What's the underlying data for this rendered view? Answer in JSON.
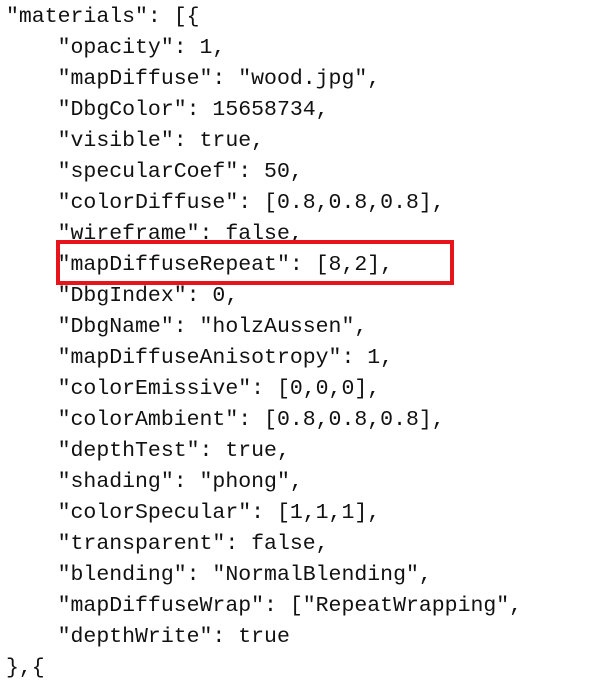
{
  "code": {
    "lines": [
      "\"materials\": [{",
      "    \"opacity\": 1,",
      "    \"mapDiffuse\": \"wood.jpg\",",
      "    \"DbgColor\": 15658734,",
      "    \"visible\": true,",
      "    \"specularCoef\": 50,",
      "    \"colorDiffuse\": [0.8,0.8,0.8],",
      "    \"wireframe\": false,",
      "    \"mapDiffuseRepeat\": [8,2],",
      "    \"DbgIndex\": 0,",
      "    \"DbgName\": \"holzAussen\",",
      "    \"mapDiffuseAnisotropy\": 1,",
      "    \"colorEmissive\": [0,0,0],",
      "    \"colorAmbient\": [0.8,0.8,0.8],",
      "    \"depthTest\": true,",
      "    \"shading\": \"phong\",",
      "    \"colorSpecular\": [1,1,1],",
      "    \"transparent\": false,",
      "    \"blending\": \"NormalBlending\",",
      "    \"mapDiffuseWrap\": [\"RepeatWrapping\",",
      "    \"depthWrite\": true",
      "},{"
    ]
  },
  "highlight": {
    "color": "#e8141c",
    "target_line": "    \"mapDiffuseRepeat\": [8,2],"
  }
}
